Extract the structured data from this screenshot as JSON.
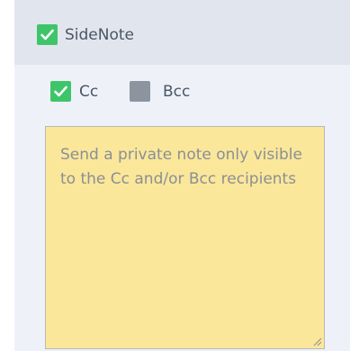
{
  "sidenote": {
    "checked": true,
    "label": "SideNote"
  },
  "recipients": {
    "cc": {
      "label": "Cc",
      "checked": true
    },
    "bcc": {
      "label": "Bcc",
      "checked": false
    }
  },
  "note": {
    "placeholder": "Send a private note only visible to the Cc and/or Bcc recipients",
    "value": ""
  },
  "colors": {
    "checked": "#3ec56a",
    "unchecked": "#8c949f",
    "note_background": "#fbe79a",
    "header_background": "#e1e6ee",
    "panel_background": "#eef2f8"
  },
  "icons": {
    "check": "check-icon",
    "resize": "resize-grip-icon"
  }
}
